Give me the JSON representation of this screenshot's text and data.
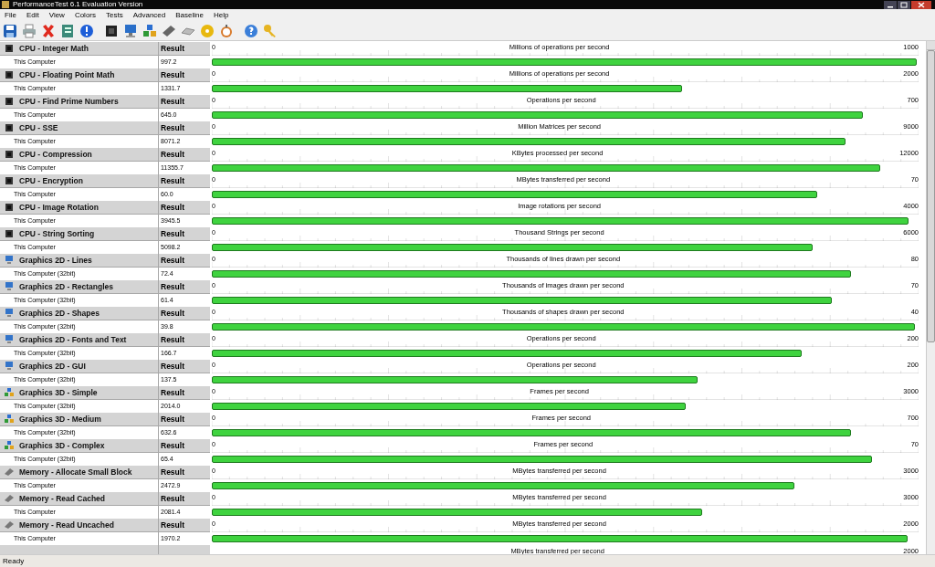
{
  "window": {
    "title": "PerformanceTest 6.1 Evaluation Version"
  },
  "menu": [
    "File",
    "Edit",
    "View",
    "Colors",
    "Tests",
    "Advanced",
    "Baseline",
    "Help"
  ],
  "toolbar": [
    {
      "kind": "save"
    },
    {
      "kind": "print"
    },
    {
      "kind": "delete"
    },
    {
      "kind": "export"
    },
    {
      "kind": "info"
    },
    {
      "kind": "cpu"
    },
    {
      "kind": "monitor"
    },
    {
      "kind": "cubes"
    },
    {
      "kind": "memory"
    },
    {
      "kind": "disk"
    },
    {
      "kind": "cd"
    },
    {
      "kind": "clock"
    },
    {
      "kind": "help"
    },
    {
      "kind": "key"
    }
  ],
  "tests": [
    {
      "kind": "cpu",
      "name": "CPU - Integer Math",
      "column": "Result",
      "computer": "This Computer",
      "result": "997.2",
      "zero": "0",
      "unit": "Millions of operations per second",
      "max": "1000",
      "level": 0.997
    },
    {
      "kind": "cpu",
      "name": "CPU - Floating Point Math",
      "column": "Result",
      "computer": "This Computer",
      "result": "1331.7",
      "zero": "0",
      "unit": "Millions of operations per second",
      "max": "2000",
      "level": 0.666
    },
    {
      "kind": "cpu",
      "name": "CPU - Find Prime Numbers",
      "column": "Result",
      "computer": "This Computer",
      "result": "645.0",
      "zero": "0",
      "unit": "Operations per second",
      "max": "700",
      "level": 0.921
    },
    {
      "kind": "cpu",
      "name": "CPU - SSE",
      "column": "Result",
      "computer": "This Computer",
      "result": "8071.2",
      "zero": "0",
      "unit": "Million Matrices per second",
      "max": "9000",
      "level": 0.897
    },
    {
      "kind": "cpu",
      "name": "CPU - Compression",
      "column": "Result",
      "computer": "This Computer",
      "result": "11355.7",
      "zero": "0",
      "unit": "KBytes processed per second",
      "max": "12000",
      "level": 0.946
    },
    {
      "kind": "cpu",
      "name": "CPU - Encryption",
      "column": "Result",
      "computer": "This Computer",
      "result": "60.0",
      "zero": "0",
      "unit": "MBytes transferred per second",
      "max": "70",
      "level": 0.857
    },
    {
      "kind": "cpu",
      "name": "CPU - Image Rotation",
      "column": "Result",
      "computer": "This Computer",
      "result": "3945.5",
      "zero": "0",
      "unit": "Image rotations per second",
      "max": "4000",
      "level": 0.986
    },
    {
      "kind": "cpu",
      "name": "CPU - String Sorting",
      "column": "Result",
      "computer": "This Computer",
      "result": "5098.2",
      "zero": "0",
      "unit": "Thousand Strings per second",
      "max": "6000",
      "level": 0.85
    },
    {
      "kind": "display",
      "name": "Graphics 2D - Lines",
      "column": "Result",
      "computer": "This Computer (32bit)",
      "result": "72.4",
      "zero": "0",
      "unit": "Thousands of lines drawn per second",
      "max": "80",
      "level": 0.905
    },
    {
      "kind": "display",
      "name": "Graphics 2D - Rectangles",
      "column": "Result",
      "computer": "This Computer (32bit)",
      "result": "61.4",
      "zero": "0",
      "unit": "Thousands of images drawn per second",
      "max": "70",
      "level": 0.877
    },
    {
      "kind": "display",
      "name": "Graphics 2D - Shapes",
      "column": "Result",
      "computer": "This Computer (32bit)",
      "result": "39.8",
      "zero": "0",
      "unit": "Thousands of shapes drawn per second",
      "max": "40",
      "level": 0.995
    },
    {
      "kind": "display",
      "name": "Graphics 2D - Fonts and Text",
      "column": "Result",
      "computer": "This Computer (32bit)",
      "result": "166.7",
      "zero": "0",
      "unit": "Operations per second",
      "max": "200",
      "level": 0.834
    },
    {
      "kind": "display",
      "name": "Graphics 2D - GUI",
      "column": "Result",
      "computer": "This Computer (32bit)",
      "result": "137.5",
      "zero": "0",
      "unit": "Operations per second",
      "max": "200",
      "level": 0.6875
    },
    {
      "kind": "scene",
      "name": "Graphics 3D - Simple",
      "column": "Result",
      "computer": "This Computer (32bit)",
      "result": "2014.0",
      "zero": "0",
      "unit": "Frames per second",
      "max": "3000",
      "level": 0.671
    },
    {
      "kind": "scene",
      "name": "Graphics 3D - Medium",
      "column": "Result",
      "computer": "This Computer (32bit)",
      "result": "632.6",
      "zero": "0",
      "unit": "Frames per second",
      "max": "700",
      "level": 0.904
    },
    {
      "kind": "scene",
      "name": "Graphics 3D - Complex",
      "column": "Result",
      "computer": "This Computer (32bit)",
      "result": "65.4",
      "zero": "0",
      "unit": "Frames per second",
      "max": "70",
      "level": 0.934
    },
    {
      "kind": "memory",
      "name": "Memory - Allocate Small Block",
      "column": "Result",
      "computer": "This Computer",
      "result": "2472.9",
      "zero": "0",
      "unit": "MBytes transferred per second",
      "max": "3000",
      "level": 0.824
    },
    {
      "kind": "memory",
      "name": "Memory - Read Cached",
      "column": "Result",
      "computer": "This Computer",
      "result": "2081.4",
      "zero": "0",
      "unit": "MBytes transferred per second",
      "max": "3000",
      "level": 0.694
    },
    {
      "kind": "memory",
      "name": "Memory - Read Uncached",
      "column": "Result",
      "computer": "This Computer",
      "result": "1970.2",
      "zero": "0",
      "unit": "MBytes transferred per second",
      "max": "2000",
      "level": 0.985
    }
  ],
  "partial_test": {
    "unit": "MBytes transferred per second",
    "max": "2000"
  },
  "status_bar": "Ready"
}
